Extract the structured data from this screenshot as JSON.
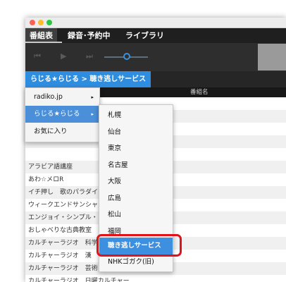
{
  "menubar": {
    "items": [
      "番組表",
      "録音･予約中",
      "ライブラリ"
    ]
  },
  "player": {
    "prev_icon": "⏮",
    "play_icon": "▶",
    "next_icon": "⏭"
  },
  "breadcrumb": "らじる★らじる > 聴き逃しサービス",
  "list_header": "番組名",
  "programs": [
    "",
    "",
    "",
    "",
    "",
    "アラビア語講座",
    "あわ☆メロR",
    "イチ押し　歌のパラダイ",
    "ウィークエンドサンシャ",
    "エンジョイ・シンプル・",
    "おしゃべりな古典教室",
    "カルチャーラジオ　科学",
    "カルチャーラジオ　漢",
    "カルチャーラジオ　芸術",
    "カルチャーラジオ　日曜カルチャー"
  ],
  "menu1": {
    "items": [
      {
        "label": "radiko.jp",
        "arrow": "▸"
      },
      {
        "label": "らじる★らじる",
        "arrow": "▸"
      },
      {
        "label": "お気に入り",
        "arrow": ""
      }
    ]
  },
  "menu2": {
    "items": [
      "札幌",
      "仙台",
      "東京",
      "名古屋",
      "大阪",
      "広島",
      "松山",
      "福岡",
      "聴き逃しサービス",
      "NHKゴガク(旧)"
    ]
  },
  "colors": {
    "accent": "#2f8de0",
    "highlight_border": "#e0121b"
  }
}
